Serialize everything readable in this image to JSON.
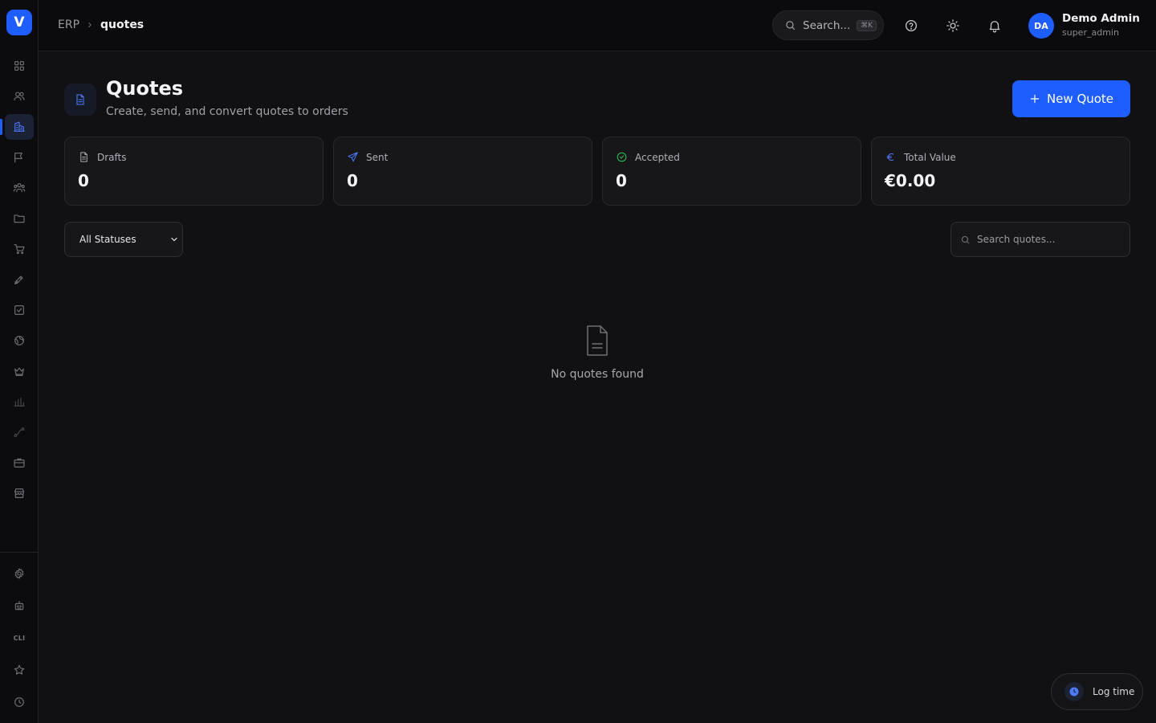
{
  "app": {
    "logo_letter": "V"
  },
  "breadcrumb": {
    "root": "ERP",
    "separator": ">",
    "current": "quotes"
  },
  "header": {
    "search_placeholder": "Search...",
    "search_shortcut": "⌘K",
    "user": {
      "initials": "DA",
      "name": "Demo Admin",
      "role": "super_admin"
    }
  },
  "sidebar": {
    "items": [
      {
        "icon": "dashboard-grid-icon"
      },
      {
        "icon": "users-icon"
      },
      {
        "icon": "company-building-icon",
        "active": true
      },
      {
        "icon": "campaign-flag-icon"
      },
      {
        "icon": "team-icon"
      },
      {
        "icon": "folder-icon"
      },
      {
        "icon": "cart-icon"
      },
      {
        "icon": "pen-tool-icon"
      },
      {
        "icon": "checkbox-icon"
      },
      {
        "icon": "globe-icon"
      },
      {
        "icon": "crown-icon"
      },
      {
        "icon": "bar-chart-icon"
      },
      {
        "icon": "workflow-icon"
      },
      {
        "icon": "briefcase-icon"
      },
      {
        "icon": "store-icon"
      }
    ],
    "bottom_items": [
      {
        "icon": "settings-gear-icon"
      },
      {
        "icon": "bot-icon"
      },
      {
        "icon": "cli-icon",
        "label": "CLI"
      },
      {
        "icon": "star-icon"
      },
      {
        "icon": "clock-icon"
      }
    ]
  },
  "page": {
    "title": "Quotes",
    "subtitle": "Create, send, and convert quotes to orders",
    "new_button_label": "New Quote"
  },
  "stats": [
    {
      "label": "Drafts",
      "value": "0",
      "icon": "document-icon",
      "color": "#a8a8b0"
    },
    {
      "label": "Sent",
      "value": "0",
      "icon": "send-icon",
      "color": "#4d7bff"
    },
    {
      "label": "Accepted",
      "value": "0",
      "icon": "check-circle-icon",
      "color": "#22c55e"
    },
    {
      "label": "Total Value",
      "value": "€0.00",
      "icon": "euro-icon",
      "color": "#4d7bff"
    }
  ],
  "filters": {
    "status_selected": "All Statuses",
    "search_placeholder": "Search quotes..."
  },
  "empty_state": {
    "message": "No quotes found"
  },
  "log_time": {
    "label": "Log time"
  },
  "colors": {
    "accent": "#1e5eff",
    "background": "#111113",
    "success": "#22c55e"
  }
}
